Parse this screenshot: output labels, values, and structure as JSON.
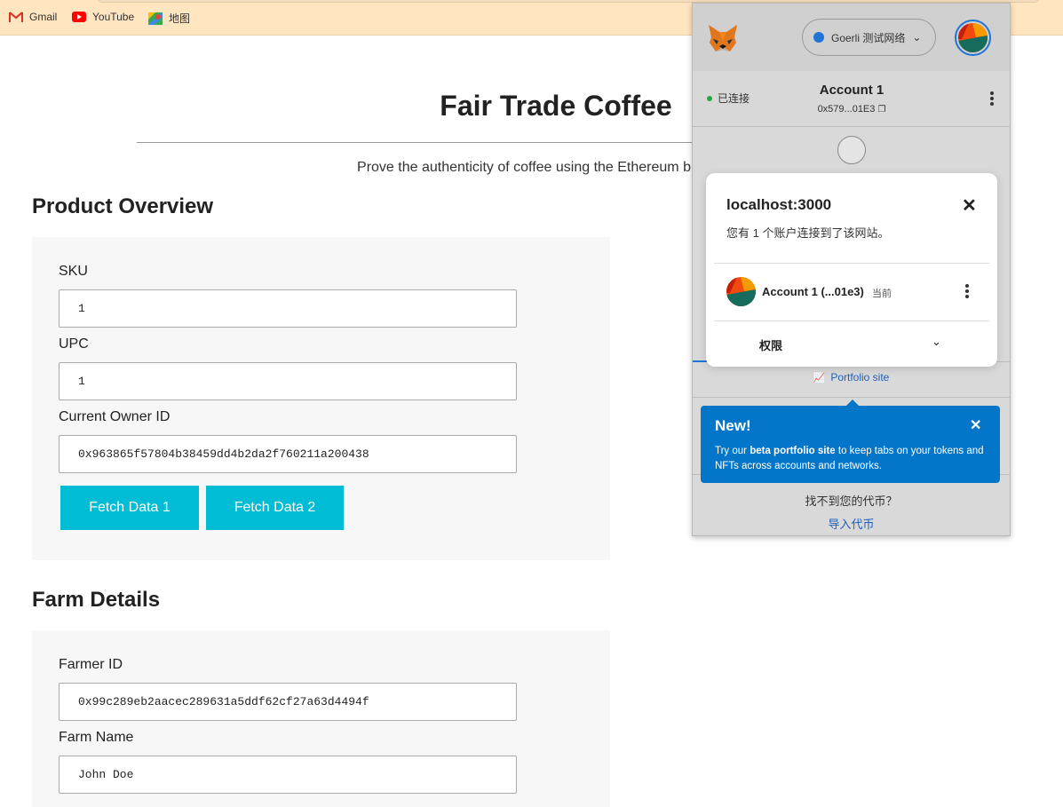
{
  "bookmarks": [
    {
      "label": "Gmail",
      "icon": "gmail-icon"
    },
    {
      "label": "YouTube",
      "icon": "youtube-icon"
    },
    {
      "label": "地图",
      "icon": "maps-icon"
    }
  ],
  "page": {
    "title": "Fair Trade Coffee",
    "subtitle": "Prove the authenticity of coffee using the Ethereum b"
  },
  "product_overview": {
    "heading": "Product Overview",
    "fields": [
      {
        "label": "SKU",
        "value": "1"
      },
      {
        "label": "UPC",
        "value": "1"
      },
      {
        "label": "Current Owner ID",
        "value": "0x963865f57804b38459dd4b2da2f760211a200438"
      }
    ],
    "buttons": [
      "Fetch Data 1",
      "Fetch Data 2"
    ]
  },
  "farm_details": {
    "heading": "Farm Details",
    "fields": [
      {
        "label": "Farmer ID",
        "value": "0x99c289eb2aacec289631a5ddf62cf27a63d4494f"
      },
      {
        "label": "Farm Name",
        "value": "John Doe"
      }
    ]
  },
  "metamask": {
    "network": "Goerli 测试网络",
    "status": "已连接",
    "account_name": "Account 1",
    "account_address": "0x579...01E3",
    "portfolio_link": "Portfolio site",
    "not_found": "找不到您的代币？",
    "import_tokens": "导入代币",
    "colors": {
      "network_dot": "#1f74d6",
      "connected_dot": "#28a745",
      "link": "#1f5fbd"
    }
  },
  "connected_dialog": {
    "site": "localhost:3000",
    "description": "您有 1 个账户连接到了该网站。",
    "account_label": "Account 1 (...01e3)",
    "current_tag": "当前",
    "permissions": "权限"
  },
  "new_tooltip": {
    "title": "New!",
    "text_before": "Try our ",
    "text_bold": "beta portfolio site",
    "text_after": " to keep tabs on your tokens and NFTs across accounts and networks.",
    "bg_color": "#0376c9"
  }
}
